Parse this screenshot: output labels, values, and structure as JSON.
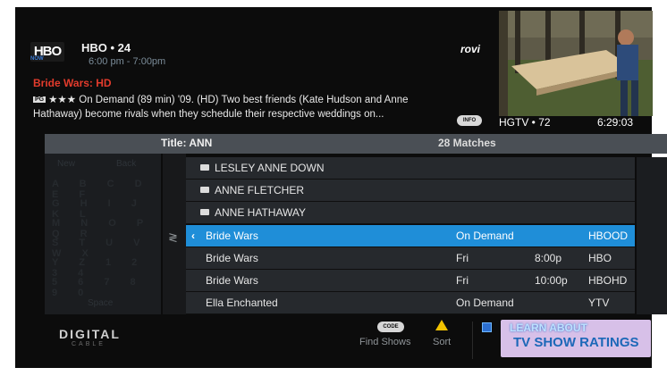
{
  "channel": {
    "logo": "HBO",
    "name": "HBO • 24",
    "time": "6:00 pm - 7:00pm"
  },
  "program": {
    "title": "Bride Wars: HD",
    "rating_badge": "PG",
    "description_line1": "★★★ On Demand (89 min) '09. (HD) Two best friends (Kate Hudson and Anne",
    "description_line2": "Hathaway) become rivals when they schedule their respective weddings on...",
    "info_button": "INFO"
  },
  "provider_logo": "rovi",
  "preview": {
    "channel": "HGTV • 72",
    "time": "6:29:03"
  },
  "search": {
    "title": "Title: ANN",
    "matches": "28 Matches"
  },
  "keyboard": {
    "new": "New",
    "back": "Back",
    "rows": [
      "A B C D E F",
      "G H I J K L",
      "M N O P Q R",
      "S T U V W X",
      "Y Z 1 2 3 4",
      "5 6 7 8 9 0"
    ],
    "space": "Space"
  },
  "folders": [
    {
      "label": "LESLEY ANNE DOWN"
    },
    {
      "label": "ANNE FLETCHER"
    },
    {
      "label": "ANNE HATHAWAY"
    }
  ],
  "results": [
    {
      "title": "Bride Wars",
      "day": "On Demand",
      "time": "",
      "channel": "HBOOD",
      "selected": true
    },
    {
      "title": "Bride Wars",
      "day": "Fri",
      "time": "8:00p",
      "channel": "HBO",
      "selected": false
    },
    {
      "title": "Bride Wars",
      "day": "Fri",
      "time": "10:00p",
      "channel": "HBOHD",
      "selected": false
    },
    {
      "title": "Ella Enchanted",
      "day": "On Demand",
      "time": "",
      "channel": "YTV",
      "selected": false
    }
  ],
  "footer": {
    "brand": "DIGITAL",
    "brand_sub": "CABLE",
    "code_pill": "CODE",
    "find_shows": "Find Shows",
    "sort": "Sort",
    "banner_line1": "LEARN ABOUT",
    "banner_line2": "TV SHOW RATINGS"
  },
  "colors": {
    "selected_row": "#1f8ed8",
    "program_title": "#e23b2c",
    "sort_icon": "#f2c200"
  }
}
